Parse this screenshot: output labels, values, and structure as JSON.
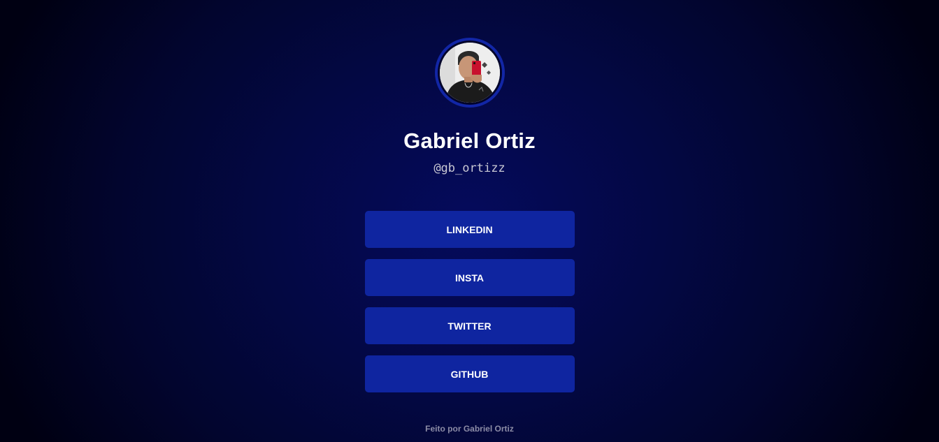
{
  "profile": {
    "avatar_icon": "profile-photo",
    "name": "Gabriel Ortiz",
    "handle": "@gb_ortizz"
  },
  "links": [
    {
      "label": "LINKEDIN"
    },
    {
      "label": "INSTA"
    },
    {
      "label": "TWITTER"
    },
    {
      "label": "GITHUB"
    }
  ],
  "footer": {
    "text": "Feito por Gabriel Ortiz"
  },
  "colors": {
    "background": "#030843",
    "button": "#0f25a0",
    "avatar_ring": "#1226a6",
    "text": "#ffffff",
    "footer_text": "#8c8ca6"
  }
}
